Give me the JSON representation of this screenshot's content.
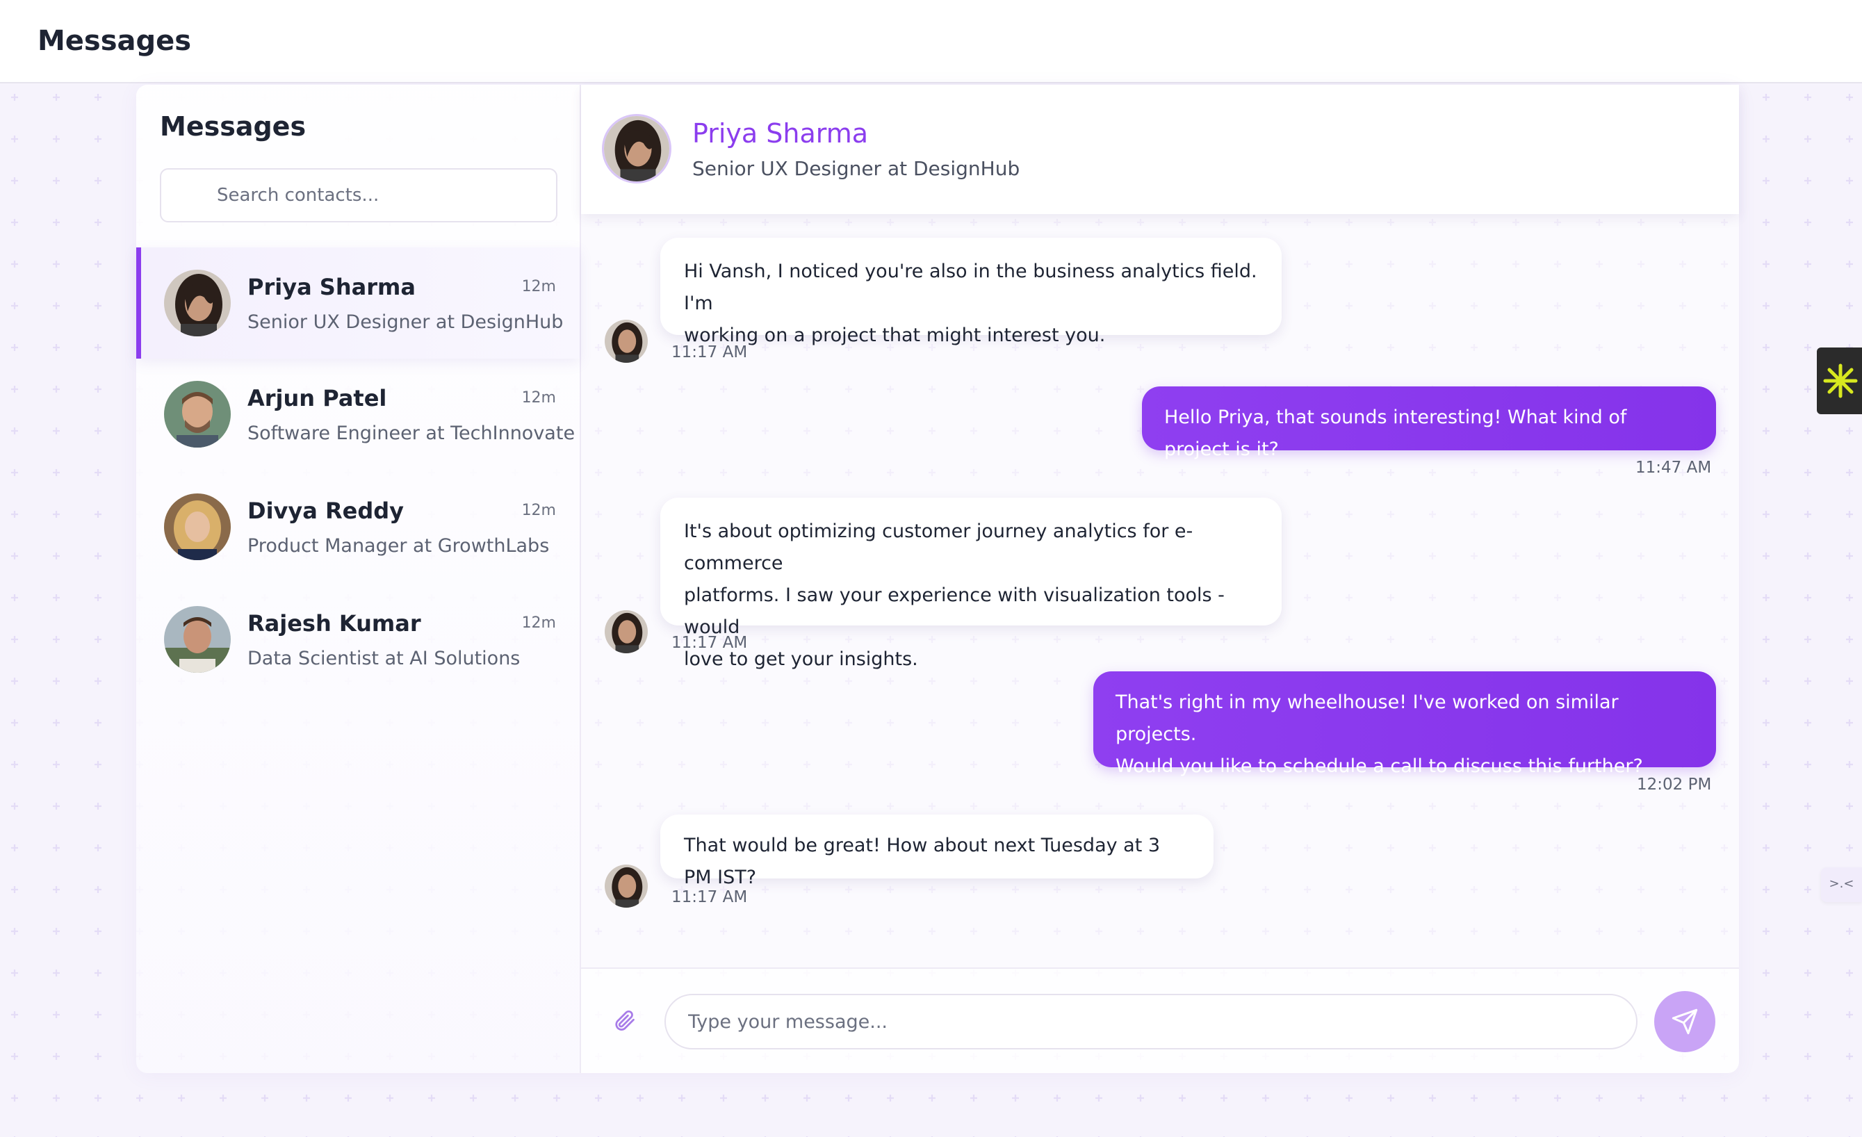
{
  "topbar": {
    "title": "Messages"
  },
  "sidebar": {
    "title": "Messages",
    "search": {
      "placeholder": "Search contacts...",
      "value": ""
    },
    "contacts": [
      {
        "name": "Priya Sharma",
        "role": "Senior UX Designer at DesignHub",
        "time": "12m",
        "active": true
      },
      {
        "name": "Arjun Patel",
        "role": "Software Engineer at TechInnovate",
        "time": "12m",
        "active": false
      },
      {
        "name": "Divya Reddy",
        "role": "Product Manager at GrowthLabs",
        "time": "12m",
        "active": false
      },
      {
        "name": "Rajesh Kumar",
        "role": "Data Scientist at AI Solutions",
        "time": "12m",
        "active": false
      }
    ]
  },
  "chat": {
    "name": "Priya Sharma",
    "role": "Senior UX Designer at DesignHub",
    "messages": [
      {
        "direction": "in",
        "text": "Hi Vansh, I noticed you're also in the business analytics field. I'm working on a project that might interest you.",
        "line1": "Hi Vansh, I noticed you're also in the business analytics field. I'm",
        "line2": "working on a project that might interest you.",
        "time": "11:17 AM"
      },
      {
        "direction": "out",
        "text": "Hello Priya, that sounds interesting! What kind of project is it?",
        "time": "11:47 AM"
      },
      {
        "direction": "in",
        "text": "It's about optimizing customer journey analytics for e-commerce platforms. I saw your experience with visualization tools - would love to get your insights.",
        "line1": "It's about optimizing customer journey analytics for e-commerce",
        "line2": "platforms. I saw your experience with visualization tools - would",
        "line3": "love to get your insights.",
        "time": "11:17 AM"
      },
      {
        "direction": "out",
        "text": "That's right in my wheelhouse! I've worked on similar projects. Would you like to schedule a call to discuss this further?",
        "line1": "That's right in my wheelhouse! I've worked on similar projects.",
        "line2": "Would you like to schedule a call to discuss this further?",
        "time": "12:02 PM"
      },
      {
        "direction": "in",
        "text": "That would be great! How about next Tuesday at 3 PM IST?",
        "time": "11:17 AM"
      }
    ]
  },
  "composer": {
    "placeholder": "Type your message...",
    "value": ""
  },
  "widgets": {
    "mini_label": ">.<"
  },
  "colors": {
    "accent": "#8b3dee",
    "send_button": "#c9a4f6",
    "background": "#f4f1fb"
  },
  "icons": {
    "search": "search-icon",
    "attach": "paperclip-icon",
    "send": "send-icon",
    "widget": "asterisk-icon"
  }
}
